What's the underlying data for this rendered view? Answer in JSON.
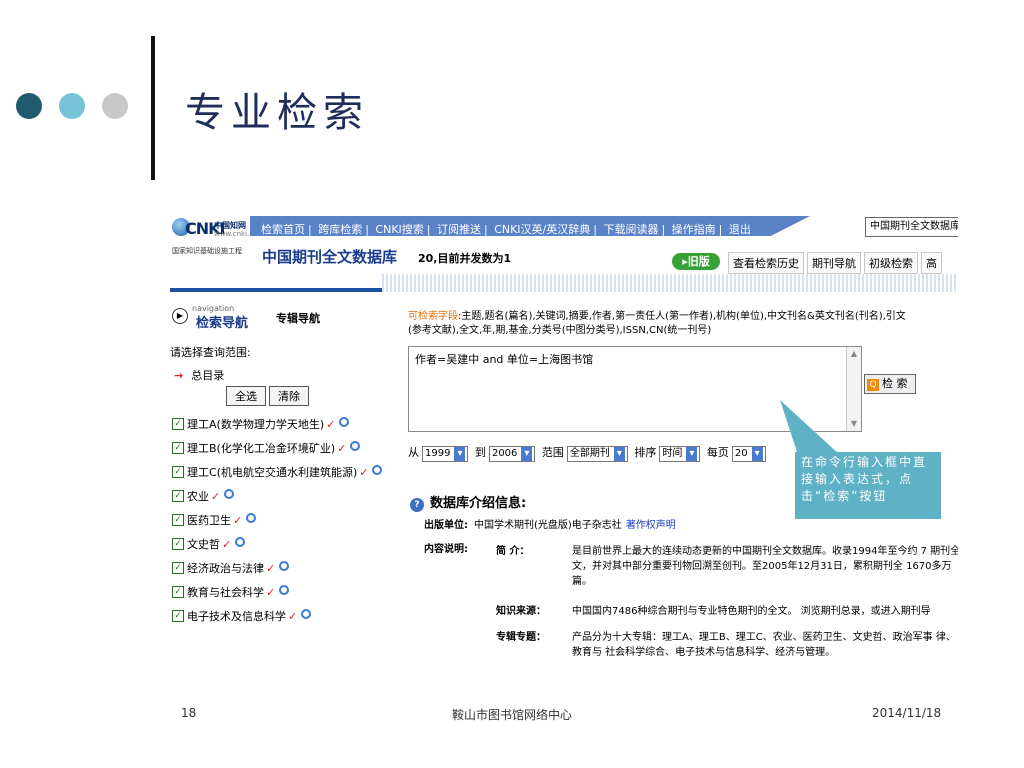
{
  "slide": {
    "title": "专业检索",
    "dot_colors": [
      "#1f5a6e",
      "#77c3d8",
      "#c8c8c8"
    ],
    "footer_page": "18",
    "footer_center": "鞍山市图书馆网络中心",
    "footer_date": "2014/11/18"
  },
  "cnki": {
    "logo": {
      "name": "CNKI",
      "cn": "中国知网",
      "url": "www.cnki.net",
      "tagline": "国家知识基础设施工程"
    },
    "nav_links": [
      "检索首页",
      "跨库检索",
      "CNKI搜索",
      "订阅推送",
      "CNKI汉英/英汉辞典",
      "下载阅读器",
      "操作指南",
      "退出"
    ],
    "db_select": "中国期刊全文数据库",
    "db_name": "中国期刊全文数据库",
    "concurrent": "20,目前并发数为1",
    "old_version": "旧版",
    "top_tabs": [
      "查看检索历史",
      "期刊导航",
      "初级检索",
      "高"
    ],
    "nav": {
      "small": "navigation",
      "title": "检索导航",
      "special": "专辑导航",
      "scope_label": "请选择查询范围:",
      "toc": "总目录",
      "select_all": "全选",
      "clear": "清除",
      "categories": [
        "理工A(数学物理力学天地生)",
        "理工B(化学化工冶金环境矿业)",
        "理工C(机电航空交通水利建筑能源)",
        "农业",
        "医药卫生",
        "文史哲",
        "经济政治与法律",
        "教育与社会科学",
        "电子技术及信息科学"
      ]
    },
    "fields_hint_label": "可检索字段",
    "fields_hint": ":主题,题名(篇名),关键词,摘要,作者,第一责任人(第一作者),机构(单位),中文刊名&英文刊名(刊名),引文(参考文献),全文,年,期,基金,分类号(中图分类号),ISSN,CN(统一刊号)",
    "query": "作者=吴建中 and 单位=上海图书馆",
    "search_button": "检 索",
    "filters": {
      "from_label": "从",
      "from_year": "1999",
      "to_label": "到",
      "to_year": "2006",
      "range_label": "范围",
      "range_value": "全部期刊",
      "sort_label": "排序",
      "sort_value": "时间",
      "per_page_label": "每页",
      "per_page_value": "20"
    },
    "callout": "在命令行输入框中直接输入表达式，点击“检索”按钮",
    "db_info": {
      "title": "数据库介绍信息:",
      "publisher_label": "出版单位:",
      "publisher": "中国学术期刊(光盘版)电子杂志社",
      "copyright": "著作权声明",
      "content_label": "内容说明:",
      "rows": [
        {
          "k": "简    介：",
          "v": "是目前世界上最大的连续动态更新的中国期刊全文数据库。收录1994年至今约 7 期刊全文，并对其中部分重要刊物回溯至创刊。至2005年12月31日，累积期刊全 1670多万篇。"
        },
        {
          "k": "知识来源：",
          "v": "中国国内7486种综合期刊与专业特色期刊的全文。 浏览期刊总录，或进入期刊导"
        },
        {
          "k": "专辑专题：",
          "v": "产品分为十大专辑：理工A、理工B、理工C、农业、医药卫生、文史哲、政治军事 律、教育与 社会科学综合、电子技术与信息科学、经济与管理。"
        }
      ]
    }
  }
}
